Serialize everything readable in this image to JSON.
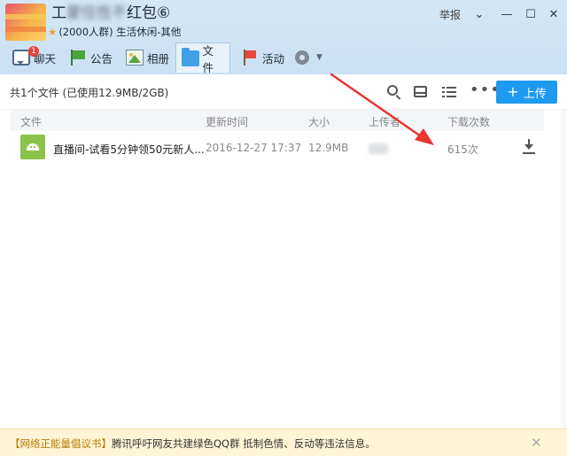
{
  "window": {
    "group_title_prefix": "工",
    "group_title_blurred": "蒙任性不",
    "group_title_suffix": "红包⑥",
    "group_meta": "(2000人群) 生活休闲-其他",
    "report_label": "举报",
    "buttons": {
      "caret": "⌄",
      "minimize": "—",
      "maximize": "☐",
      "close": "✕"
    }
  },
  "tabs": [
    {
      "label": "聊天",
      "icon": "chat-icon",
      "badge": "1"
    },
    {
      "label": "公告",
      "icon": "flag-icon"
    },
    {
      "label": "相册",
      "icon": "album-icon"
    },
    {
      "label": "文件",
      "icon": "folder-icon",
      "active": true
    },
    {
      "label": "活动",
      "icon": "activity-flag-icon"
    },
    {
      "label": "",
      "icon": "more-icon"
    }
  ],
  "toolbar": {
    "summary": "共1个文件 (已使用12.9MB/2GB)",
    "upload_label": "上传",
    "upload_plus": "+",
    "dots": "•••"
  },
  "table": {
    "headers": [
      "文件",
      "更新时间",
      "大小",
      "上传者",
      "下载次数"
    ],
    "rows": [
      {
        "name": "直播间-试看5分钟领50元新人...",
        "date": "2016-12-27 17:37",
        "size": "12.9MB",
        "uploader": "",
        "downloads": "615次"
      }
    ]
  },
  "notice": {
    "title": "【网络正能量倡议书】",
    "text": "腾讯呼吁网友共建绿色QQ群 抵制色情、反动等违法信息。",
    "close": "✕"
  },
  "colors": {
    "header_bg": "#d4e7f6",
    "upload_button": "#1e9af0",
    "annotation_arrow": "#e8372f",
    "notice_bg": "#fff5d6"
  }
}
